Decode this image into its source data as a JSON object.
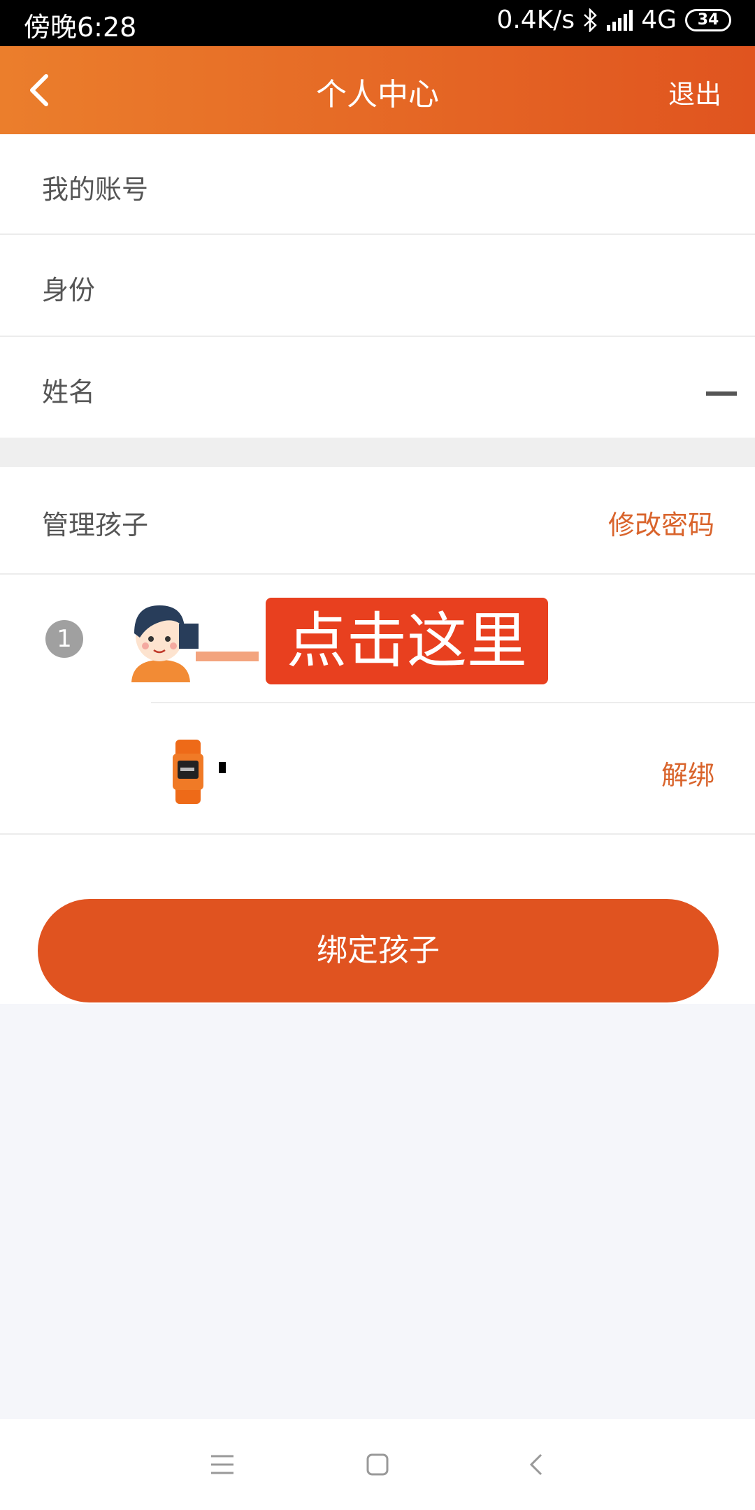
{
  "status": {
    "time": "傍晚6:28",
    "speed": "0.4K/s",
    "network": "4G",
    "battery": "34"
  },
  "header": {
    "title": "个人中心",
    "logout": "退出"
  },
  "profile": {
    "account_label": "我的账号",
    "identity_label": "身份",
    "name_label": "姓名"
  },
  "manage": {
    "title": "管理孩子",
    "change_password": "修改密码"
  },
  "child": {
    "index": "1",
    "callout": "点击这里",
    "unbind": "解绑"
  },
  "bind_button": "绑定孩子",
  "colors": {
    "accent": "#e05320",
    "header_start": "#eb7e2c",
    "callout": "#e8401f"
  }
}
